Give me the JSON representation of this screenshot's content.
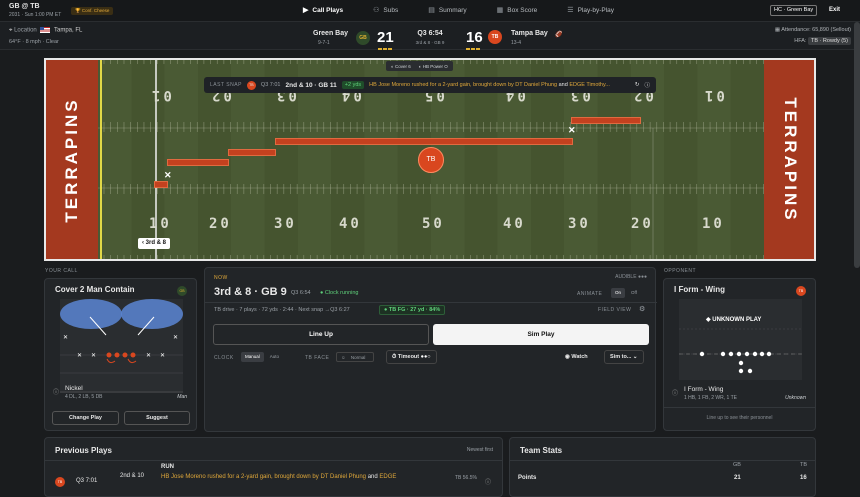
{
  "header": {
    "matchup": "GB @ TB",
    "season": "2031 · Sun 1:00 PM ET",
    "conference": "Conf. Cheese",
    "hc": "HC · Green Bay",
    "exit": "Exit",
    "tabs": [
      {
        "icon": "▶",
        "label": "Call Plays",
        "active": true
      },
      {
        "icon": "⚇",
        "label": "Subs"
      },
      {
        "icon": "▤",
        "label": "Summary"
      },
      {
        "icon": "▦",
        "label": "Box Score"
      },
      {
        "icon": "☰",
        "label": "Play-by-Play"
      }
    ]
  },
  "game": {
    "location_label": "Location",
    "location": "Tampa, FL",
    "weather": "64°F · 8 mph · Clear",
    "away": {
      "name": "Green Bay",
      "record": "9-7-1",
      "abbr": "GB",
      "score": "21"
    },
    "home": {
      "name": "Tampa Bay",
      "record": "13-4",
      "abbr": "TB",
      "score": "16"
    },
    "clock": "Q3 6:54",
    "down": "3rd & 8 · GB 9",
    "attendance": "Attendance: 65,890 (Sellout)",
    "hfa_label": "HFA:",
    "hfa": "TB · Rowdy (5)"
  },
  "field": {
    "endzone": "TERRAPINS",
    "yard_top": [
      "01",
      "02",
      "03",
      "04",
      "05",
      "04",
      "03",
      "02",
      "01"
    ],
    "yard_bottom": [
      "10",
      "20",
      "30",
      "40",
      "50",
      "40",
      "30",
      "20",
      "10"
    ],
    "formation_left": "Cover 6",
    "formation_right": "HB Power O",
    "marker": "3rd & 8",
    "ball_team": "TB",
    "last_snap": {
      "label": "LAST SNAP",
      "team": "TB",
      "time": "Q3 7:01",
      "situation": "2nd & 10 · GB 11",
      "gain": "+2 yds",
      "desc_pre": "HB Jose Moreno rushed for a 2-yard gain, brought down by",
      "t1": "DT Daniel Phung",
      "and": "and",
      "t2": "EDGE Timothy..."
    }
  },
  "your_call": {
    "label": "YOUR CALL",
    "title": "Cover 2 Man Contain",
    "badge": "GB",
    "personnel": "Nickel",
    "personnel_sub": "4 DL, 2 LB, 5 DB",
    "coverage": "Man",
    "change": "Change Play",
    "suggest": "Suggest"
  },
  "now": {
    "label": "NOW",
    "audible": "AUDIBLE",
    "situation": "3rd & 8 · GB 9",
    "clock": "Q3 6:54",
    "status": "Clock running",
    "animate": "ANIMATE",
    "on": "On",
    "off": "Off",
    "drive": "TB drive · 7 plays · 72 yds · 2:44 · Next snap →Q3 6:27",
    "fg": "TB FG · 27 yd · 84%",
    "field_view": "FIELD VIEW",
    "line_up": "Line Up",
    "sim_play": "Sim Play",
    "clock_label": "CLOCK",
    "manual": "Manual",
    "auto": "Auto",
    "tb_face": "TB FACE",
    "normal": "Normal",
    "timeout": "Timeout",
    "watch": "Watch",
    "sim_to": "Sim to..."
  },
  "opponent": {
    "label": "OPPONENT",
    "title": "I Form - Wing",
    "badge": "TB",
    "unknown": "UNKNOWN PLAY",
    "formation": "I Form - Wing",
    "formation_sub": "1 HB, 1 FB, 2 WR, 1 TE",
    "coverage": "Unknown",
    "hint": "Line up to see their personnel"
  },
  "previous": {
    "title": "Previous Plays",
    "sort": "Newest first",
    "row": {
      "team": "TB",
      "time": "Q3 7:01",
      "down": "2nd & 10",
      "type": "RUN",
      "desc": "HB Jose Moreno rushed for a 2-yard gain, brought down by",
      "t1": "DT Daniel Phung",
      "and": "and",
      "t2": "EDGE",
      "pct": "TB 56.5%"
    }
  },
  "team_stats": {
    "title": "Team Stats",
    "col1": "GB",
    "col2": "TB",
    "rows": [
      {
        "label": "Points",
        "a": "21",
        "b": "16"
      }
    ]
  },
  "colors": {
    "accent": "#e0a83a",
    "tb": "#d9471f",
    "gb": "#2f4a2a",
    "field": "#4a5a34",
    "endzone": "#a4391f",
    "drive": "#c4411f"
  }
}
